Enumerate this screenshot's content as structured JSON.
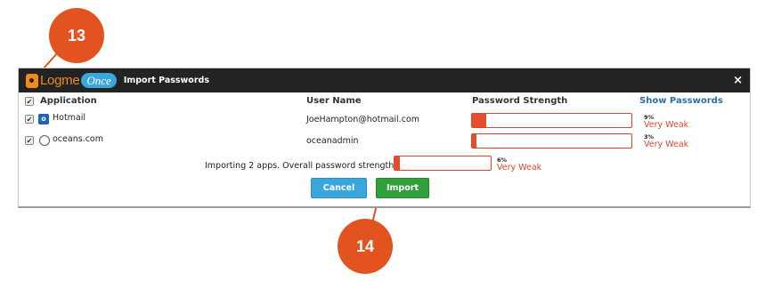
{
  "callouts": {
    "first": "13",
    "second": "14"
  },
  "window": {
    "logo_text": "Logme",
    "logo_badge": "Once",
    "title": "Import Passwords",
    "close_icon": "×"
  },
  "table": {
    "columns": [
      "Application",
      "User Name",
      "Password Strength",
      "Show Passwords"
    ],
    "rows": [
      {
        "app": "Hotmail",
        "icon": "outlook-icon",
        "username": "JoeHampton@hotmail.com",
        "percent": "9%",
        "strength": "Very Weak",
        "level": 0.09
      },
      {
        "app": "oceans.com",
        "icon": "globe-icon",
        "username": "oceanadmin",
        "percent": "3%",
        "strength": "Very Weak",
        "level": 0.03
      }
    ]
  },
  "summary": {
    "text": "Importing 2 apps. Overall password strength is",
    "percent": "6%",
    "strength": "Very Weak",
    "level": 0.06
  },
  "buttons": {
    "cancel": "Cancel",
    "import": "Import"
  },
  "colors": {
    "callout": "#e2531f",
    "weak": "#d9472b",
    "cancel": "#3aa6dd",
    "import": "#2fa03b"
  }
}
